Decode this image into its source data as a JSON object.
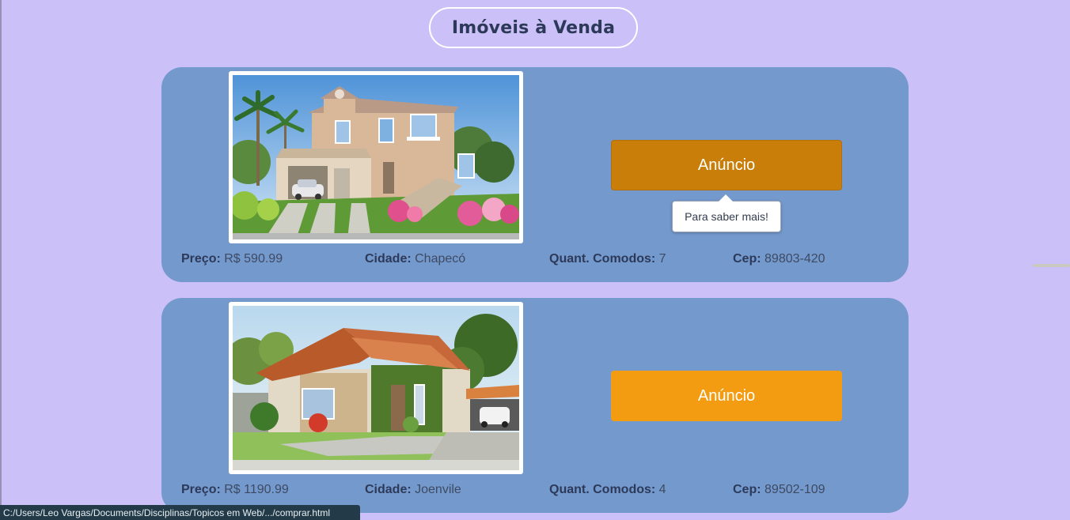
{
  "page": {
    "title": "Imóveis à Venda"
  },
  "listings": [
    {
      "button_label": "Anúncio",
      "tooltip": "Para saber mais!",
      "price_label": "Preço:",
      "price": "R$ 590.99",
      "city_label": "Cidade:",
      "city": "Chapecó",
      "rooms_label": "Quant. Comodos:",
      "rooms": "7",
      "cep_label": "Cep:",
      "cep": "89803-420"
    },
    {
      "button_label": "Anúncio",
      "price_label": "Preço:",
      "price": "R$ 1190.99",
      "city_label": "Cidade:",
      "city": "Joenvile",
      "rooms_label": "Quant. Comodos:",
      "rooms": "4",
      "cep_label": "Cep:",
      "cep": "89502-109"
    }
  ],
  "status_bar": {
    "url": "C:/Users/Leo Vargas/Documents/Disciplinas/Topicos em Web/.../comprar.html"
  },
  "colors": {
    "background": "#cbc0f7",
    "card": "#7499cd",
    "button_hover": "#c87e08",
    "button": "#f39c12"
  }
}
